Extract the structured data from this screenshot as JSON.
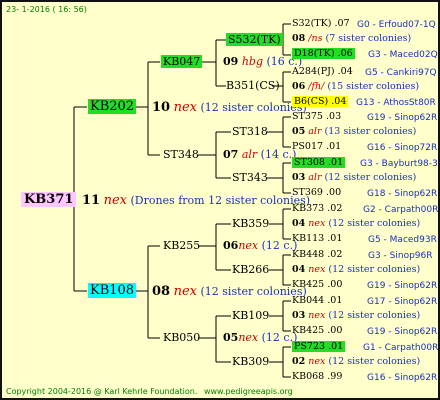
{
  "header": {
    "date": "23- 1-2016 ( 16: 56)"
  },
  "footer": {
    "copyright": "Copyright 2004-2016 @ Karl Kehrle Foundation.",
    "site": "www.pedigreeapis.org"
  },
  "root": {
    "id": "KB371",
    "gen": "11",
    "race": "nex",
    "note": "(Drones from 12 sister colonies)"
  },
  "l1": {
    "upper": {
      "id": "KB202",
      "gen": "10",
      "race": "nex",
      "note": "(12 sister colonies)"
    },
    "lower": {
      "id": "KB108",
      "gen": "08",
      "race": "nex",
      "note": "(12 sister colonies)"
    }
  },
  "l2": {
    "kb047": {
      "id": "KB047",
      "gen": "09",
      "race": "hbg",
      "note": "(16 c.)"
    },
    "st348": {
      "id": "ST348",
      "gen": "07",
      "race": "alr",
      "note": "(14 c.)"
    },
    "kb255": {
      "id": "KB255",
      "gen": "06",
      "race": "nex",
      "note": "(12 c.)"
    },
    "kb050": {
      "id": "KB050",
      "gen": "05",
      "race": "nex",
      "note": "(12 c.)"
    }
  },
  "l3": {
    "s532": "S532(TK)",
    "b351": "B351(CS)",
    "st318": "ST318",
    "st343": "ST343",
    "kb359": "KB359",
    "kb266": "KB266",
    "kb109": "KB109",
    "kb309": "KB309"
  },
  "l4": [
    {
      "id": "S32(TK)",
      "val": ".07",
      "gen": "G0 - Erfoud07-1Q"
    },
    {
      "gen_no": "08",
      "race": "/ns",
      "note": "(7 sister colonies)"
    },
    {
      "id": "D18(TK)",
      "val": ".06",
      "gen": "G3 - Maced02Q"
    },
    {
      "id": "A284(PJ)",
      "val": ".04",
      "gen": "G5 - Cankiri97Q"
    },
    {
      "gen_no": "06",
      "race": "/fh/",
      "note": "(15 sister colonies)"
    },
    {
      "id": "B6(CS)",
      "val": ".04",
      "gen": "G13 - AthosSt80R"
    },
    {
      "id": "ST375",
      "val": ".03",
      "gen": "G19 - Sinop62R"
    },
    {
      "gen_no": "05",
      "race": "alr",
      "note": "(13 sister colonies)"
    },
    {
      "id": "PS017",
      "val": ".01",
      "gen": "G16 - Sinop72R"
    },
    {
      "id": "ST308",
      "val": ".01",
      "gen": "G3 - Bayburt98-3"
    },
    {
      "gen_no": "03",
      "race": "alr",
      "note": "(12 sister colonies)"
    },
    {
      "id": "ST369",
      "val": ".00",
      "gen": "G18 - Sinop62R"
    },
    {
      "id": "KB373",
      "val": ".02",
      "gen": "G2 - Carpath00R"
    },
    {
      "gen_no": "04",
      "race": "nex",
      "note": "(12 sister colonies)"
    },
    {
      "id": "KB113",
      "val": ".01",
      "gen": "G5 - Maced93R"
    },
    {
      "id": "KB448",
      "val": ".02",
      "gen": "G3 - Sinop96R"
    },
    {
      "gen_no": "04",
      "race": "nex",
      "note": "(12 sister colonies)"
    },
    {
      "id": "KB425",
      "val": ".00",
      "gen": "G19 - Sinop62R"
    },
    {
      "id": "KB044",
      "val": ".01",
      "gen": "G17 - Sinop62R"
    },
    {
      "gen_no": "03",
      "race": "nex",
      "note": "(12 sister colonies)"
    },
    {
      "id": "KB425",
      "val": ".00",
      "gen": "G19 - Sinop62R"
    },
    {
      "id": "PS723",
      "val": ".01",
      "gen": "G1 - Carpath00R"
    },
    {
      "gen_no": "02",
      "race": "nex",
      "note": "(12 sister colonies)"
    },
    {
      "id": "KB068",
      "val": ".99",
      "gen": "G16 - Sinop62R"
    }
  ]
}
